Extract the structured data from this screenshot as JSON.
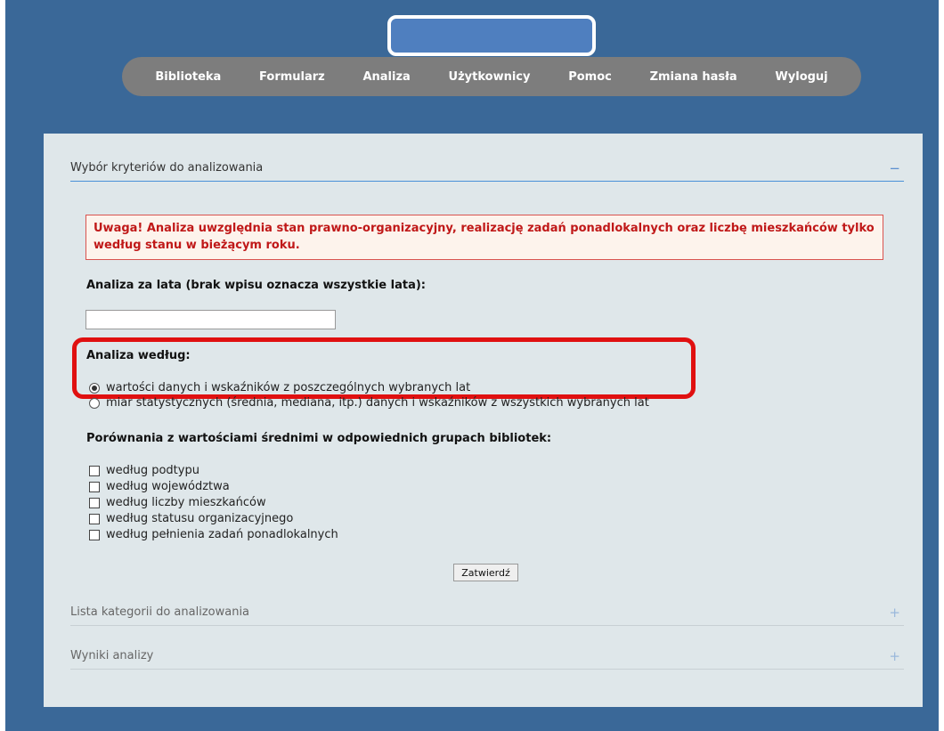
{
  "nav": {
    "items": [
      {
        "label": "Biblioteka"
      },
      {
        "label": "Formularz"
      },
      {
        "label": "Analiza"
      },
      {
        "label": "Użytkownicy"
      },
      {
        "label": "Pomoc"
      },
      {
        "label": "Zmiana hasła"
      },
      {
        "label": "Wyloguj"
      }
    ]
  },
  "sections": {
    "criteria": {
      "title": "Wybór kryteriów do analizowania",
      "sign": "−"
    },
    "categories": {
      "title": "Lista kategorii do analizowania",
      "sign": "+"
    },
    "results": {
      "title": "Wyniki analizy",
      "sign": "+"
    }
  },
  "warning": "Uwaga! Analiza uwzględnia stan prawno-organizacyjny, realizację zadań ponadlokalnych oraz liczbę mieszkańców tylko według stanu w bieżącym roku.",
  "years": {
    "label": "Analiza za lata (brak wpisu oznacza wszystkie lata):",
    "value": ""
  },
  "method": {
    "label": "Analiza według:",
    "options": [
      {
        "label": "wartości danych i wskaźników z poszczególnych wybranych lat",
        "selected": true
      },
      {
        "label": "miar statystycznych (średnia, mediana, itp.) danych i wskaźników z wszystkich wybranych lat",
        "selected": false
      }
    ]
  },
  "compare": {
    "label": "Porównania z wartościami średnimi w odpowiednich grupach bibliotek:",
    "options": [
      {
        "label": "według podtypu",
        "checked": false
      },
      {
        "label": "według województwa",
        "checked": false
      },
      {
        "label": "według liczby mieszkańców",
        "checked": false
      },
      {
        "label": "według statusu organizacyjnego",
        "checked": false
      },
      {
        "label": "według pełnienia zadań ponadlokalnych",
        "checked": false
      }
    ]
  },
  "submit_label": "Zatwierdź",
  "colors": {
    "background": "#3a6898",
    "nav": "#7d7d7d",
    "panel": "#dfe7ea",
    "warning_text": "#c01818",
    "highlight": "#e01010"
  }
}
